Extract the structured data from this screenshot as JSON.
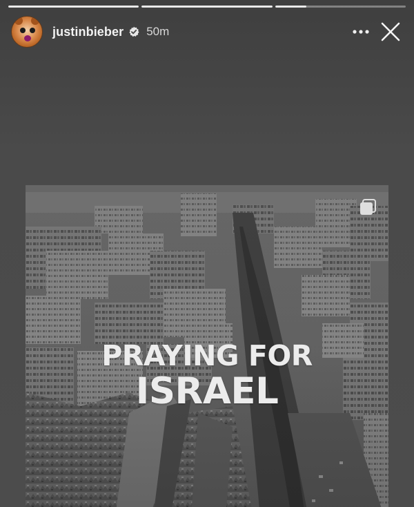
{
  "story": {
    "progress": [
      {
        "value": 1.0
      },
      {
        "value": 1.0
      },
      {
        "value": 0.24
      }
    ],
    "user": {
      "username": "justinbieber",
      "verified": true,
      "time_ago": "50m"
    },
    "header": {
      "more_icon": "more-horizontal-icon",
      "more_label": "•••",
      "close_icon": "close-icon"
    }
  },
  "post": {
    "headline_line1": "PRAYING FOR",
    "headline_line2": "ISRAEL",
    "carousel_icon": "multiple-images-icon",
    "tone": "grayscale aerial city photo"
  },
  "colors": {
    "background": "#4b4b4b",
    "text": "#ffffff",
    "progress_fill": "#e9e9e9"
  }
}
